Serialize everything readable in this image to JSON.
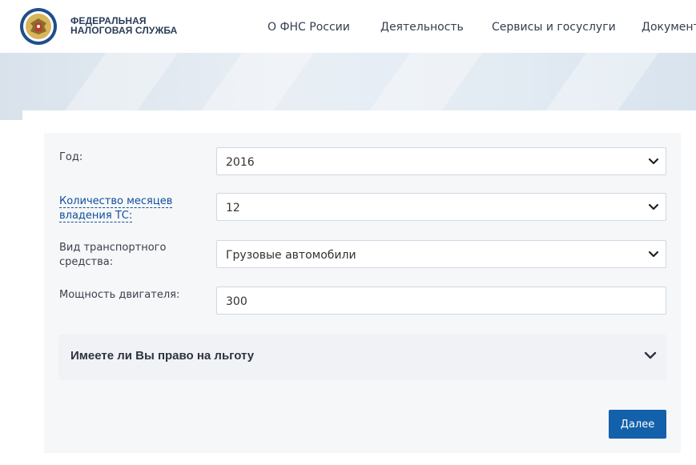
{
  "header": {
    "logo_line1": "ФЕДЕРАЛЬНАЯ",
    "logo_line2": "НАЛОГОВАЯ СЛУЖБА",
    "nav": [
      {
        "label": "О ФНС России"
      },
      {
        "label": "Деятельность"
      },
      {
        "label": "Сервисы и госуслуги"
      },
      {
        "label": "Документ"
      }
    ]
  },
  "form": {
    "fields": [
      {
        "label": "Год:",
        "value": "2016",
        "icon": "chevron-down-icon"
      },
      {
        "label": "Количество месяцев владения ТС:",
        "value": "12",
        "icon": "chevron-down-icon"
      },
      {
        "label": "Вид транспортного средства:",
        "value": "Грузовые автомобили",
        "icon": "chevron-down-icon"
      },
      {
        "label": "Мощность двигателя:",
        "value": "300"
      }
    ],
    "benefit_title": "Имеете ли Вы право на льготу",
    "next_label": "Далее"
  },
  "colors": {
    "primary": "#1360ab",
    "link": "#0f4f9c",
    "panel": "#f6f7f9"
  }
}
